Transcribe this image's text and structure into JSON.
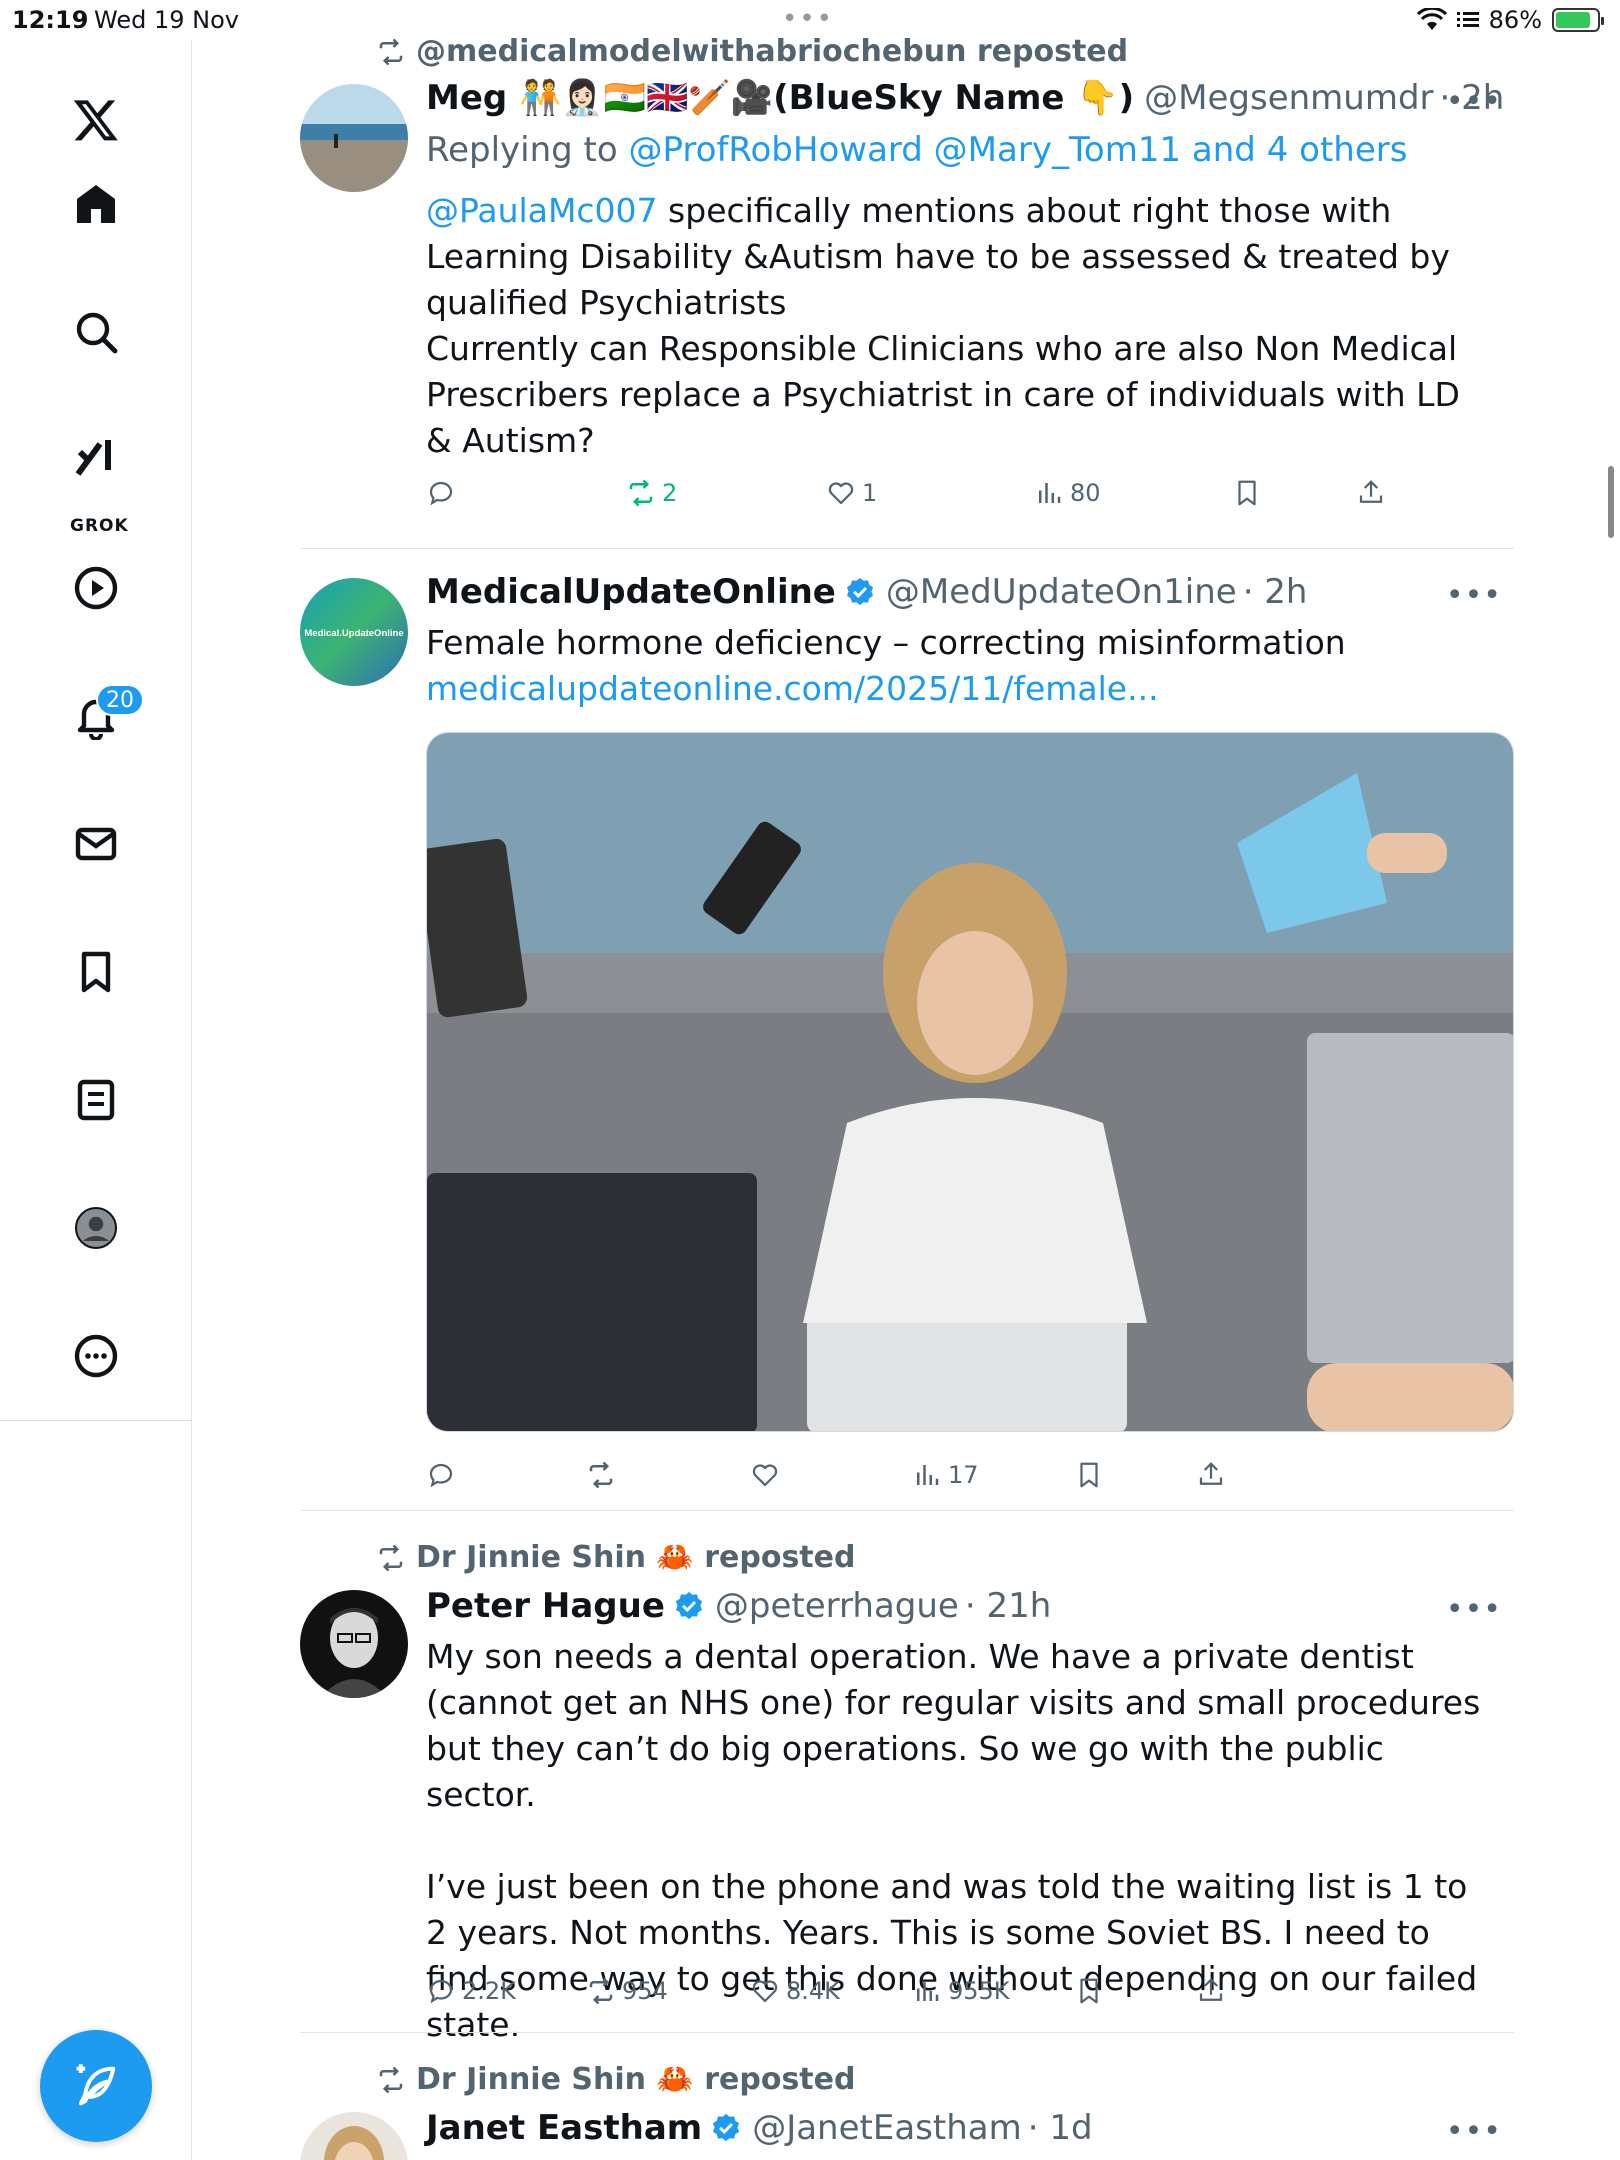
{
  "status_bar": {
    "time": "12:19",
    "date": "Wed 19 Nov",
    "battery": "86%",
    "battery_level": 0.86
  },
  "sidebar": {
    "items": [
      {
        "icon": "x-logo-icon"
      },
      {
        "icon": "home-icon"
      },
      {
        "icon": "search-icon"
      },
      {
        "icon": "grok-icon",
        "label": "GROK"
      },
      {
        "icon": "video-icon"
      },
      {
        "icon": "bell-icon",
        "badge": "20"
      },
      {
        "icon": "mail-icon"
      },
      {
        "icon": "bookmark-icon"
      },
      {
        "icon": "lists-icon"
      },
      {
        "icon": "profile-icon"
      },
      {
        "icon": "more-icon"
      }
    ],
    "compose_icon": "compose-feather-icon"
  },
  "posts": [
    {
      "repost_by": "@medicalmodelwithabriochebun reposted",
      "name": "Meg 🧑‍🤝‍🧑👩🏻‍⚕️🇮🇳🇬🇧🏏🎥(BlueSky Name 👇)",
      "handle": "@Megsenmumdr",
      "time": "· 2h",
      "replying_prefix": "Replying to ",
      "replying_to": "@ProfRobHoward @Mary_Tom11 and 4 others",
      "mention": "@PaulaMc007",
      "text_line1": " specifically mentions about right those with Learning Disability &Autism have to be assessed & treated by qualified Psychiatrists",
      "text_line2": "Currently can Responsible Clinicians who are also Non Medical Prescribers replace a Psychiatrist in care of individuals with LD & Autism?",
      "replies": "",
      "reposts": "2",
      "likes": "1",
      "views": "80"
    },
    {
      "repost_by": "",
      "name": "MedicalUpdateOnline",
      "handle": "@MedUpdateOn1ine",
      "time": "· 2h",
      "avatar_text": "Medical.UpdateOnline",
      "text": "Female hormone deficiency – correcting misinformation",
      "link": "medicalupdateonline.com/2025/11/female...",
      "replies": "",
      "reposts": "",
      "likes": "",
      "views": "17"
    },
    {
      "repost_by": "Dr Jinnie Shin 🦀 reposted",
      "name": "Peter Hague",
      "handle": "@peterrhague",
      "time": "· 21h",
      "para1": "My son needs a dental operation. We have a private dentist (cannot get an NHS one) for regular visits and small procedures but they can’t do big operations. So we go with the public sector.",
      "para2": "I’ve just been on the phone and was told the waiting list is 1 to 2 years. Not months. Years. This is some Soviet BS. I need to find some way to get this done without depending on our failed state.",
      "replies": "2.2K",
      "reposts": "954",
      "likes": "8.4K",
      "views": "955K"
    },
    {
      "repost_by": "Dr Jinnie Shin 🦀 reposted",
      "name": "Janet Eastham",
      "handle": "@JanetEastham",
      "time": "· 1d"
    }
  ],
  "colors": {
    "accent": "#1d9bf0",
    "repost_green": "#00ba7c",
    "muted": "#536471"
  }
}
